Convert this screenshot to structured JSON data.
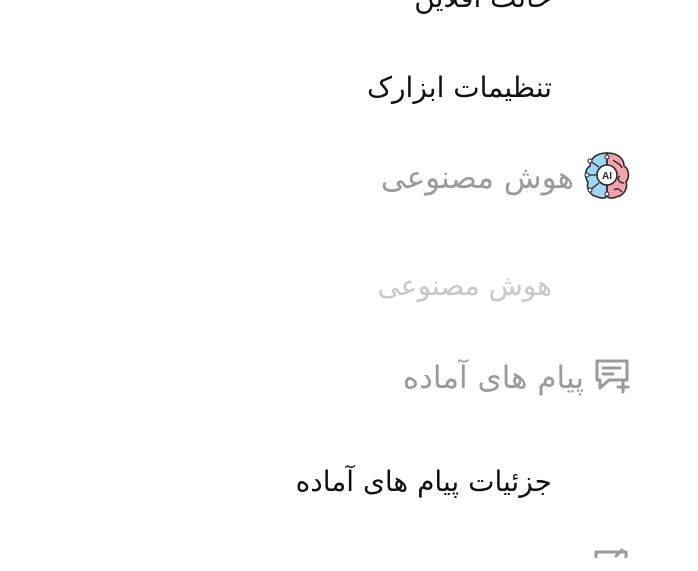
{
  "menu": {
    "top_partial_label": "حالت آفلاین",
    "toolbar_settings": "تنظیمات ابزارک",
    "ai_item": {
      "label": "هوش مصنوعی",
      "icon": "ai-brain-icon",
      "icon_badge": "AI"
    },
    "ai_disabled_label": "هوش مصنوعی",
    "quick_messages": {
      "label": "پیام های آماده",
      "icon": "message-add-icon"
    },
    "quick_messages_details": "جزئیات پیام های آماده",
    "next_item_icon": "edit-icon"
  },
  "colors": {
    "heading": "#111111",
    "item": "#9a9a9a",
    "disabled": "#c7c7c7",
    "brain_blue": "#9fd6f2",
    "brain_pink": "#f4a3ad"
  }
}
